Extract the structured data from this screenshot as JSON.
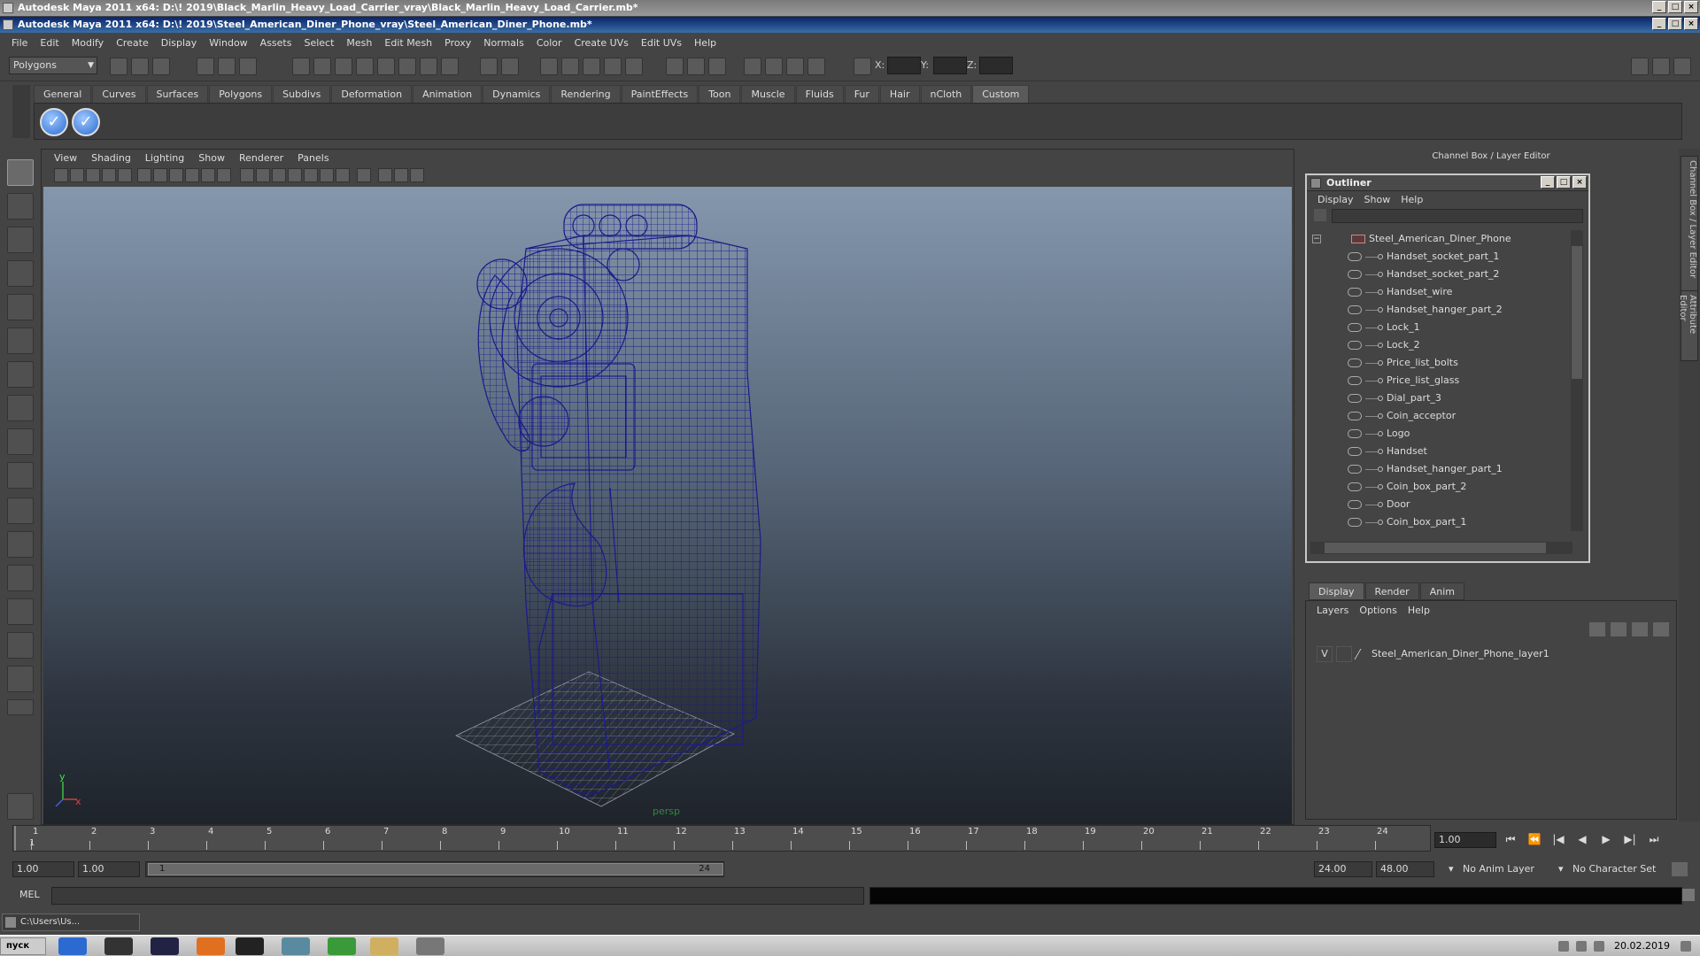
{
  "windows": {
    "back_title": "Autodesk Maya 2011 x64: D:\\! 2019\\Black_Marlin_Heavy_Load_Carrier_vray\\Black_Marlin_Heavy_Load_Carrier.mb*",
    "front_title": "Autodesk Maya 2011 x64: D:\\! 2019\\Steel_American_Diner_Phone_vray\\Steel_American_Diner_Phone.mb*"
  },
  "menubar": [
    "File",
    "Edit",
    "Modify",
    "Create",
    "Display",
    "Window",
    "Assets",
    "Select",
    "Mesh",
    "Edit Mesh",
    "Proxy",
    "Normals",
    "Color",
    "Create UVs",
    "Edit UVs",
    "Help"
  ],
  "toolbar": {
    "mode_selector": "Polygons",
    "x_label": "X:",
    "y_label": "Y:",
    "z_label": "Z:"
  },
  "shelf": {
    "tabs": [
      "General",
      "Curves",
      "Surfaces",
      "Polygons",
      "Subdivs",
      "Deformation",
      "Animation",
      "Dynamics",
      "Rendering",
      "PaintEffects",
      "Toon",
      "Muscle",
      "Fluids",
      "Fur",
      "Hair",
      "nCloth",
      "Custom"
    ],
    "active_tab": "Custom",
    "check_glyph": "✓"
  },
  "viewport": {
    "menu": [
      "View",
      "Shading",
      "Lighting",
      "Show",
      "Renderer",
      "Panels"
    ],
    "camera_label": "persp",
    "axis_y": "y",
    "axis_x": "x"
  },
  "channel_box": {
    "title": "Channel Box / Layer Editor",
    "side_tabs": [
      "Channel Box / Layer Editor",
      "Attribute Editor"
    ]
  },
  "outliner": {
    "title": "Outliner",
    "menu": [
      "Display",
      "Show",
      "Help"
    ],
    "root": "Steel_American_Diner_Phone",
    "items": [
      "Handset_socket_part_1",
      "Handset_socket_part_2",
      "Handset_wire",
      "Handset_hanger_part_2",
      "Lock_1",
      "Lock_2",
      "Price_list_bolts",
      "Price_list_glass",
      "Dial_part_3",
      "Coin_acceptor",
      "Logo",
      "Handset",
      "Handset_hanger_part_1",
      "Coin_box_part_2",
      "Door",
      "Coin_box_part_1"
    ]
  },
  "layer_editor": {
    "tabs": [
      "Display",
      "Render",
      "Anim"
    ],
    "active_tab": "Display",
    "menu": [
      "Layers",
      "Options",
      "Help"
    ],
    "layers": [
      {
        "visible": "V",
        "name": "Steel_American_Diner_Phone_layer1"
      }
    ]
  },
  "timeline": {
    "ticks": [
      "1",
      "2",
      "3",
      "4",
      "5",
      "6",
      "7",
      "8",
      "9",
      "10",
      "11",
      "12",
      "13",
      "14",
      "15",
      "16",
      "17",
      "18",
      "19",
      "20",
      "21",
      "22",
      "23",
      "24"
    ],
    "current_frame_label": "1",
    "current_frame_field": "1.00"
  },
  "range": {
    "start_field": "1.00",
    "playback_start": "1.00",
    "slider_start": "1",
    "slider_end": "24",
    "playback_end": "24.00",
    "end_field": "48.00",
    "anim_layer": "No Anim Layer",
    "character_set": "No Character Set"
  },
  "command_line": {
    "label": "MEL"
  },
  "minimized_window": "C:\\Users\\Us...",
  "taskbar": {
    "start_label": "пуск",
    "date": "20.02.2019"
  },
  "colors": {
    "wireframe": "#1a1a8c",
    "accent": "#2a6ad0"
  }
}
